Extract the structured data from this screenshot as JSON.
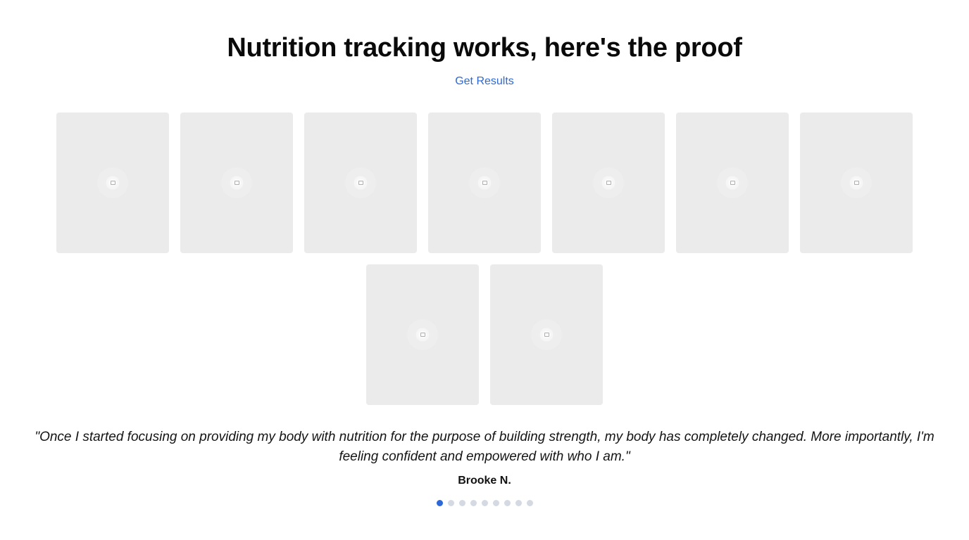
{
  "section": {
    "title": "Nutrition tracking works, here's the proof",
    "cta_label": "Get Results"
  },
  "gallery": {
    "rows": [
      {
        "items": [
          {
            "icon": "image-placeholder-icon"
          },
          {
            "icon": "image-placeholder-icon"
          },
          {
            "icon": "image-placeholder-icon"
          },
          {
            "icon": "image-placeholder-icon"
          },
          {
            "icon": "image-placeholder-icon"
          },
          {
            "icon": "image-placeholder-icon"
          },
          {
            "icon": "image-placeholder-icon"
          }
        ]
      },
      {
        "items": [
          {
            "icon": "image-placeholder-icon"
          },
          {
            "icon": "image-placeholder-icon"
          }
        ]
      }
    ]
  },
  "testimonial": {
    "quote": "\"Once I started focusing on providing my body with nutrition for the purpose of building strength, my body has completely changed. More importantly, I'm feeling confident and empowered with who I am.\"",
    "author": "Brooke N."
  },
  "pagination": {
    "total": 9,
    "active_index": 0,
    "active_color": "#2c68d6",
    "inactive_color": "#d5d9e2"
  }
}
